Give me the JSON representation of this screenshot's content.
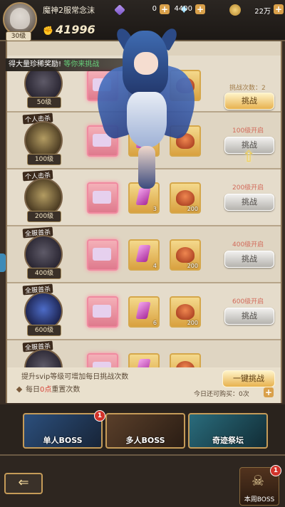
{
  "player": {
    "name": "魔神2服常念沫",
    "level": "30级",
    "power": "41996"
  },
  "resources": [
    {
      "icon": "stamina-icon",
      "value": "0"
    },
    {
      "icon": "gem-icon",
      "value": "4400"
    },
    {
      "icon": "coin-icon",
      "value": "22万"
    }
  ],
  "announcement": {
    "text": "得大量珍稀奖励!",
    "tail": "等你来挑战"
  },
  "daily_count_label": "挑战次数：2",
  "challenge_label": "挑战",
  "arrow_icon": "up-arrow-icon",
  "bosses": [
    {
      "title": "",
      "level": "50级",
      "unlock": "",
      "items": [
        "ticket",
        "gem",
        "pot"
      ],
      "qty": [
        "",
        "",
        ""
      ],
      "active": true
    },
    {
      "title": "个人击杀",
      "level": "100级",
      "unlock": "100级开启",
      "items": [
        "ticket",
        "gem",
        "pot"
      ],
      "qty": [
        "",
        "",
        ""
      ],
      "active": false
    },
    {
      "title": "个人击杀",
      "level": "200级",
      "unlock": "200级开启",
      "items": [
        "ticket",
        "gem",
        "pot"
      ],
      "qty": [
        "",
        "3",
        "200"
      ],
      "active": false
    },
    {
      "title": "全服首杀",
      "level": "400级",
      "unlock": "400级开启",
      "items": [
        "ticket",
        "gem",
        "pot"
      ],
      "qty": [
        "",
        "4",
        "200"
      ],
      "active": false
    },
    {
      "title": "全服首杀",
      "level": "600级",
      "unlock": "600级开启",
      "items": [
        "ticket",
        "gem",
        "pot"
      ],
      "qty": [
        "",
        "6",
        "200"
      ],
      "active": false
    },
    {
      "title": "全服首杀",
      "level": "",
      "unlock": "",
      "items": [
        "ticket",
        "gem",
        "pot"
      ],
      "qty": [
        "",
        "",
        ""
      ],
      "active": false
    }
  ],
  "info": {
    "svip_tip": "提升svip等级可增加每日挑战次数",
    "reset_prefix": "每日",
    "reset_time": "0点",
    "reset_suffix": "重置次数",
    "sweep_label": "一键挑战",
    "buy_text": "今日还可购买：0次"
  },
  "tabs": [
    {
      "label": "单人BOSS",
      "badge": "1"
    },
    {
      "label": "多人BOSS",
      "badge": ""
    },
    {
      "label": "奇迹祭坛",
      "badge": ""
    }
  ],
  "bottom": {
    "back_icon": "back-arrow-icon",
    "week_boss": "本周BOSS",
    "week_badge": "1"
  }
}
